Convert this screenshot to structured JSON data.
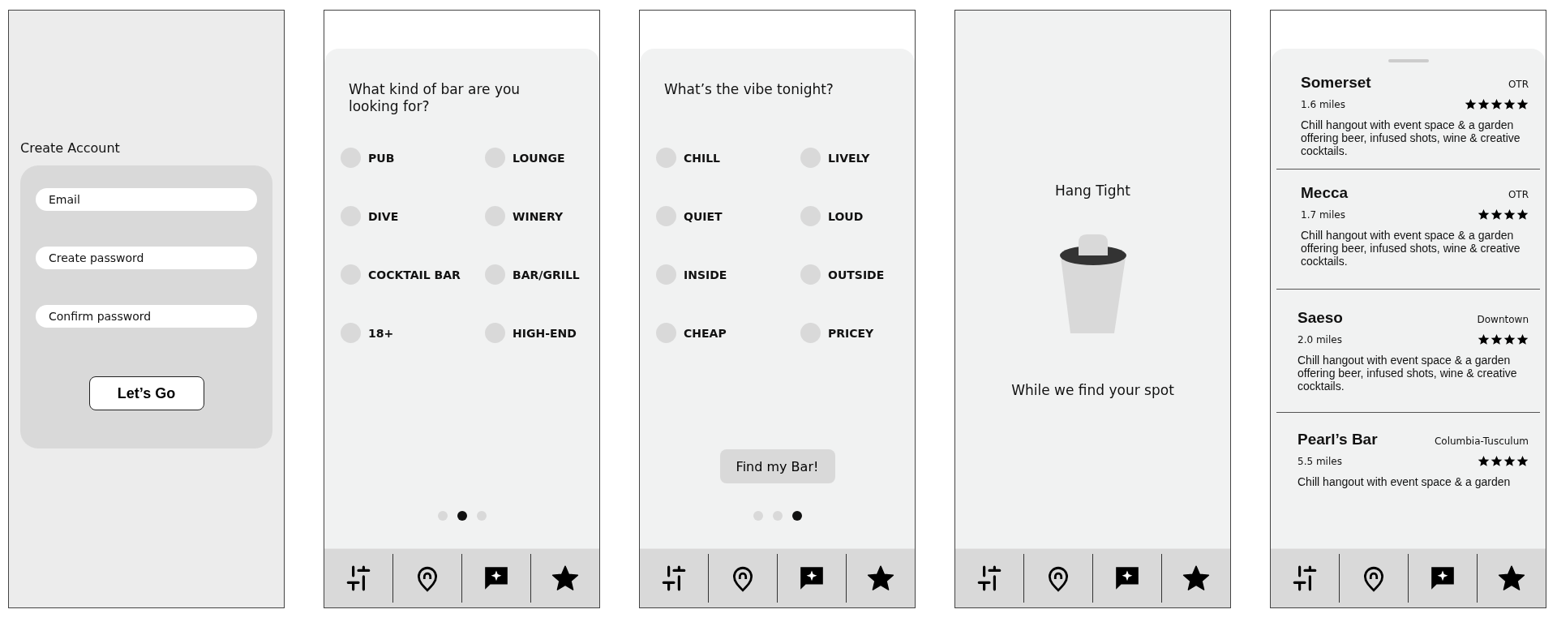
{
  "screens": [
    {
      "kind": "signup",
      "title": "Create Account",
      "fields": [
        {
          "placeholder": "Email"
        },
        {
          "placeholder": "Create password"
        },
        {
          "placeholder": "Confirm password"
        }
      ],
      "button": "Let’s Go"
    },
    {
      "kind": "quiz",
      "question": "What kind of bar are you looking for?",
      "options": [
        {
          "label": "PUB",
          "selected": false
        },
        {
          "label": "LOUNGE",
          "selected": false
        },
        {
          "label": "DIVE",
          "selected": false
        },
        {
          "label": "WINERY",
          "selected": false
        },
        {
          "label": "COCKTAIL BAR",
          "selected": false
        },
        {
          "label": "BAR/GRILL",
          "selected": false
        },
        {
          "label": "18+",
          "selected": false
        },
        {
          "label": "HIGH-END",
          "selected": false
        }
      ],
      "pager": [
        {
          "selected": false
        },
        {
          "selected": true
        },
        {
          "selected": false
        }
      ]
    },
    {
      "kind": "quiz",
      "question": "What’s the vibe tonight?",
      "options": [
        {
          "label": "CHILL",
          "selected": false
        },
        {
          "label": "LIVELY",
          "selected": false
        },
        {
          "label": "QUIET",
          "selected": false
        },
        {
          "label": "LOUD",
          "selected": false
        },
        {
          "label": "INSIDE",
          "selected": false
        },
        {
          "label": "OUTSIDE",
          "selected": false
        },
        {
          "label": "CHEAP",
          "selected": false
        },
        {
          "label": "PRICEY",
          "selected": false
        }
      ],
      "button": "Find my Bar!",
      "pager": [
        {
          "selected": false
        },
        {
          "selected": false
        },
        {
          "selected": true
        }
      ]
    },
    {
      "kind": "loading",
      "title": "Hang Tight",
      "subtitle": "While we find your spot"
    },
    {
      "kind": "results",
      "bars": [
        {
          "name": "Somerset",
          "area": "OTR",
          "distance": "1.6 miles",
          "stars": 5,
          "description": "Chill hangout with event space & a garden offering beer, infused shots, wine & creative cocktails."
        },
        {
          "name": "Mecca",
          "area": "OTR",
          "distance": "1.7 miles",
          "stars": 4,
          "description": "Chill hangout with event space & a garden offering beer, infused shots, wine & creative cocktails."
        },
        {
          "name": "Saeso",
          "area": "Downtown",
          "distance": "2.0 miles",
          "stars": 4,
          "description": "Chill hangout with event space & a garden offering beer, infused shots, wine & creative cocktails."
        },
        {
          "name": "Pearl’s Bar",
          "area": "Columbia-Tusculum",
          "distance": "5.5 miles",
          "stars": 4,
          "description": "Chill hangout with event space & a garden"
        }
      ]
    }
  ]
}
